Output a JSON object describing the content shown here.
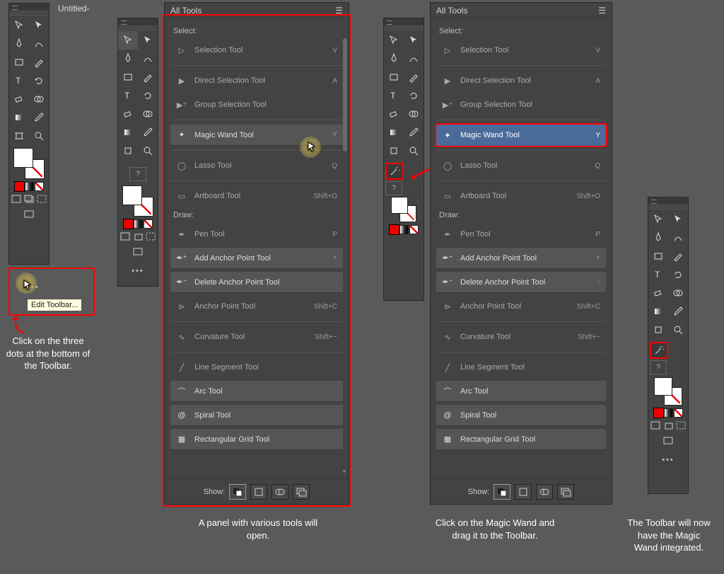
{
  "tab_title": "Untitled-",
  "alltools": {
    "header": "All Tools",
    "categories": {
      "select": "Select:",
      "draw": "Draw:"
    },
    "select_tools": [
      {
        "label": "Selection Tool",
        "key": "V",
        "icon": "selection"
      },
      {
        "label": "Direct Selection Tool",
        "key": "A",
        "icon": "direct-selection"
      },
      {
        "label": "Group Selection Tool",
        "key": "",
        "icon": "group-selection"
      },
      {
        "label": "Magic Wand Tool",
        "key": "Y",
        "icon": "magic-wand"
      },
      {
        "label": "Lasso Tool",
        "key": "Q",
        "icon": "lasso"
      },
      {
        "label": "Artboard Tool",
        "key": "Shift+O",
        "icon": "artboard"
      }
    ],
    "draw_tools": [
      {
        "label": "Pen Tool",
        "key": "P",
        "icon": "pen"
      },
      {
        "label": "Add Anchor Point Tool",
        "key": "+",
        "icon": "pen-plus"
      },
      {
        "label": "Delete Anchor Point Tool",
        "key": "-",
        "icon": "pen-minus"
      },
      {
        "label": "Anchor Point Tool",
        "key": "Shift+C",
        "icon": "anchor"
      },
      {
        "label": "Curvature Tool",
        "key": "Shift+~",
        "icon": "curvature"
      },
      {
        "label": "Line Segment Tool",
        "key": "",
        "icon": "line"
      },
      {
        "label": "Arc Tool",
        "key": "",
        "icon": "arc"
      },
      {
        "label": "Spiral Tool",
        "key": "",
        "icon": "spiral"
      },
      {
        "label": "Rectangular Grid Tool",
        "key": "",
        "icon": "grid"
      }
    ],
    "footer_label": "Show:"
  },
  "tooltip": "Edit Toolbar...",
  "captions": {
    "c1": "Click on the three dots at the bottom of the Toolbar.",
    "c2": "A panel with various tools will open.",
    "c3": "Click on the Magic Wand and drag it to the Toolbar.",
    "c4": "The Toolbar will now have the Magic Wand integrated."
  }
}
